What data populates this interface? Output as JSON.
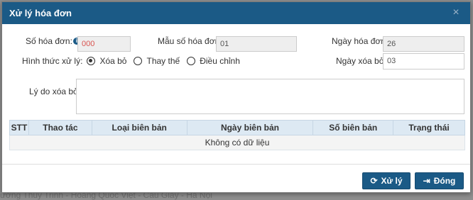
{
  "background": {
    "text": "ương Thủy Trinh - Hoàng Quốc Việt - Cầu Giấy - Hà Nội"
  },
  "dialog": {
    "title": "Xử lý hóa đơn",
    "close_icon": "×"
  },
  "form": {
    "invoice_no_label": "Số hóa đơn:",
    "invoice_no_value": "000",
    "template_label": "Mẫu số hóa đơn:",
    "template_value": "01",
    "invoice_date_label": "Ngày hóa đơn:",
    "invoice_date_value": "26",
    "method_label": "Hình thức xử lý:",
    "methods": [
      {
        "label": "Xóa bỏ",
        "checked": true
      },
      {
        "label": "Thay thế",
        "checked": false
      },
      {
        "label": "Điều chỉnh",
        "checked": false
      }
    ],
    "delete_date_label": "Ngày xóa bỏ:",
    "delete_date_value": "03",
    "reason_label": "Lý do xóa bỏ:",
    "reason_value": ""
  },
  "table": {
    "columns": [
      "STT",
      "Thao tác",
      "Loại biên bản",
      "Ngày biên bản",
      "Số biên bản",
      "Trạng thái"
    ],
    "empty_text": "Không có dữ liệu"
  },
  "buttons": {
    "process": {
      "label": "Xử lý",
      "icon": "refresh-icon"
    },
    "close": {
      "label": "Đóng",
      "icon": "exit-icon"
    }
  },
  "colors": {
    "header": "#1b5a86",
    "table_header": "#dde9f3"
  }
}
